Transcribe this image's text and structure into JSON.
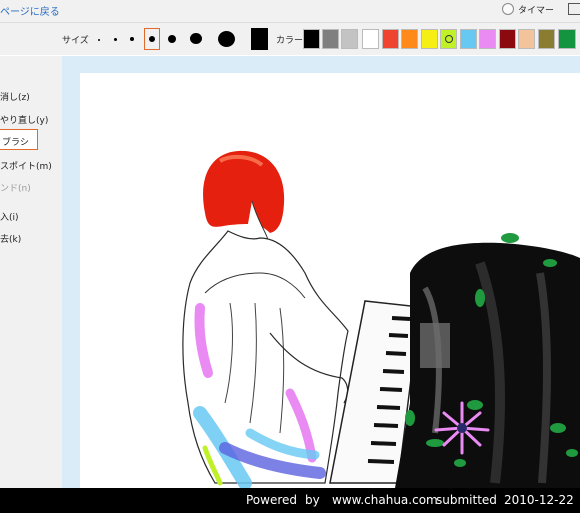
{
  "header": {
    "back_link": "ページに戻る",
    "timer_label": "タイマー"
  },
  "toolbar": {
    "size_label": "サイズ",
    "color_label": "カラー",
    "colors": [
      "#000000",
      "#7f7f7f",
      "#c3c3c3",
      "#ffffff",
      "#ee4430",
      "#ff8a1a",
      "#f6ef15",
      "#bff028",
      "#67c9f2",
      "#e98bf3",
      "#8b0a10",
      "#f3c49c",
      "#8a7d32",
      "#14943e"
    ]
  },
  "menu": {
    "undo": "消し(z)",
    "redo": "やり直し(y)",
    "brush": "ブラシ",
    "eyedropper": "スポイト(m)",
    "blend": "ンド(n)",
    "insert": "入(i)",
    "clear": "去(k)"
  },
  "footer": {
    "powered": "Powered",
    "by": "by",
    "site": "www.chahua.com",
    "submitted": "submitted",
    "date": "2010-12-22"
  }
}
